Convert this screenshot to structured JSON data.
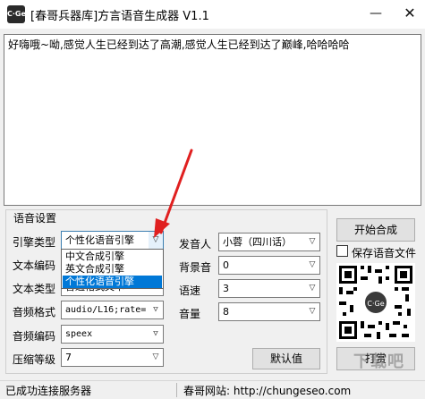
{
  "window": {
    "title": "[春哥兵器库]方言语音生成器 V1.1",
    "icon_text": "C·Ge",
    "minimize_glyph": "—",
    "close_glyph": "✕"
  },
  "text_input": {
    "value": "好嗨哦~呦,感觉人生已经到达了高潮,感觉人生已经到达了巅峰,哈哈哈哈"
  },
  "voice_settings": {
    "group_label": "语音设置",
    "engine_type": {
      "label": "引擎类型",
      "value": "个性化语音引擎"
    },
    "engine_dropdown": {
      "options": [
        "中文合成引擎",
        "英文合成引擎",
        "个性化语音引擎"
      ],
      "selected_index": 2
    },
    "text_encoding": {
      "label": "文本编码",
      "value": ""
    },
    "text_type": {
      "label": "文本类型",
      "value": "普通格式文本"
    },
    "audio_format": {
      "label": "音频格式",
      "value": "audio/L16;rate="
    },
    "audio_encoding": {
      "label": "音频编码",
      "value": "speex"
    },
    "compression_level": {
      "label": "压缩等级",
      "value": "7"
    },
    "speaker": {
      "label": "发音人",
      "value": "小蓉（四川话）"
    },
    "background_sound": {
      "label": "背景音",
      "value": "0"
    },
    "speed": {
      "label": "语速",
      "value": "3"
    },
    "volume": {
      "label": "音量",
      "value": "8"
    },
    "default_button": "默认值"
  },
  "actions": {
    "start_button": "开始合成",
    "save_checkbox_label": "保存语音文件",
    "save_checked": false,
    "tip_button": "打赏",
    "qr_badge": "C·Ge"
  },
  "statusbar": {
    "connection": "已成功连接服务器",
    "website": "春哥网站: http://chungeseo.com"
  },
  "watermark": "下载吧",
  "colors": {
    "selection": "#0078d7",
    "annotation_arrow": "#e02020"
  }
}
